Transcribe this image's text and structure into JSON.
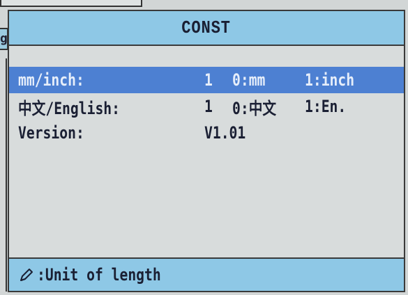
{
  "dialog": {
    "title": "CONST"
  },
  "rows": [
    {
      "label": "mm/inch:",
      "value": "1",
      "option0": "0:mm",
      "option1": "1:inch",
      "selected": true
    },
    {
      "label": "中文/English:",
      "value": "1",
      "option0": "0:中文",
      "option1": "1:En.",
      "selected": false
    },
    {
      "label": "Version:",
      "value": "V1.01",
      "option0": "",
      "option1": "",
      "selected": false
    }
  ],
  "status": {
    "icon": "pencil-icon",
    "text": ":Unit of length"
  },
  "background": {
    "partial_label": "g"
  },
  "colors": {
    "title_bar": "#8ec8e6",
    "selection": "#4d80d2",
    "dialog_bg": "#d8dcdc",
    "text": "#1a1f33"
  }
}
